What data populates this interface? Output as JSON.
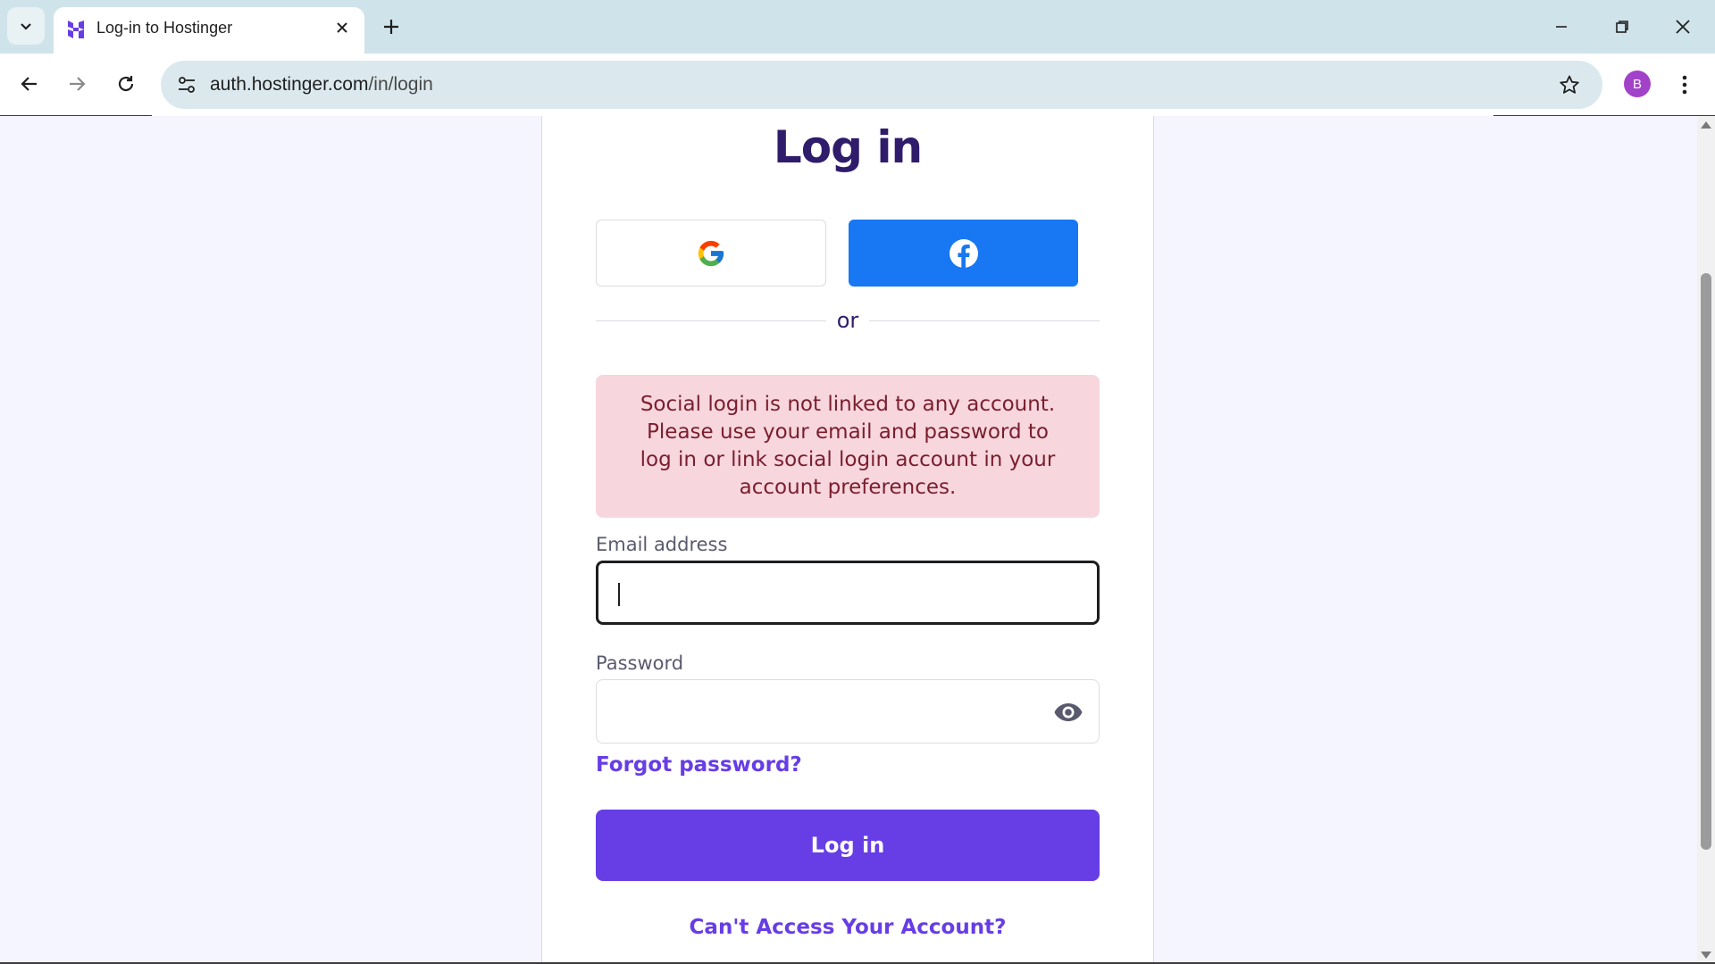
{
  "browser": {
    "tab": {
      "title": "Log-in to Hostinger"
    },
    "address_bar": {
      "host": "auth.hostinger.com",
      "path": "/in/login"
    },
    "profile_initial": "B"
  },
  "page": {
    "heading": "Log in",
    "divider_text": "or",
    "alert": "Social login is not linked to any account. Please use your email and password to log in or link social login account in your account preferences.",
    "email_label": "Email address",
    "email_value": "",
    "password_label": "Password",
    "password_value": "",
    "forgot_link": "Forgot password?",
    "login_button": "Log in",
    "cant_access_link": "Can't Access Your Account?"
  },
  "colors": {
    "brand_purple": "#673de6",
    "heading": "#2f1c6a",
    "facebook_blue": "#1877f2",
    "alert_bg": "#f7d6dd",
    "alert_text": "#7a1e2e"
  },
  "icons": {
    "tab_search": "chevron-down-icon",
    "favicon": "hostinger-logo-icon",
    "tab_close": "close-icon",
    "new_tab": "plus-icon",
    "back": "arrow-left-icon",
    "forward": "arrow-right-icon",
    "reload": "reload-icon",
    "site_info": "tune-icon",
    "bookmark": "star-icon",
    "menu": "kebab-menu-icon",
    "google": "google-logo-icon",
    "facebook": "facebook-logo-icon",
    "show_password": "eye-icon"
  }
}
